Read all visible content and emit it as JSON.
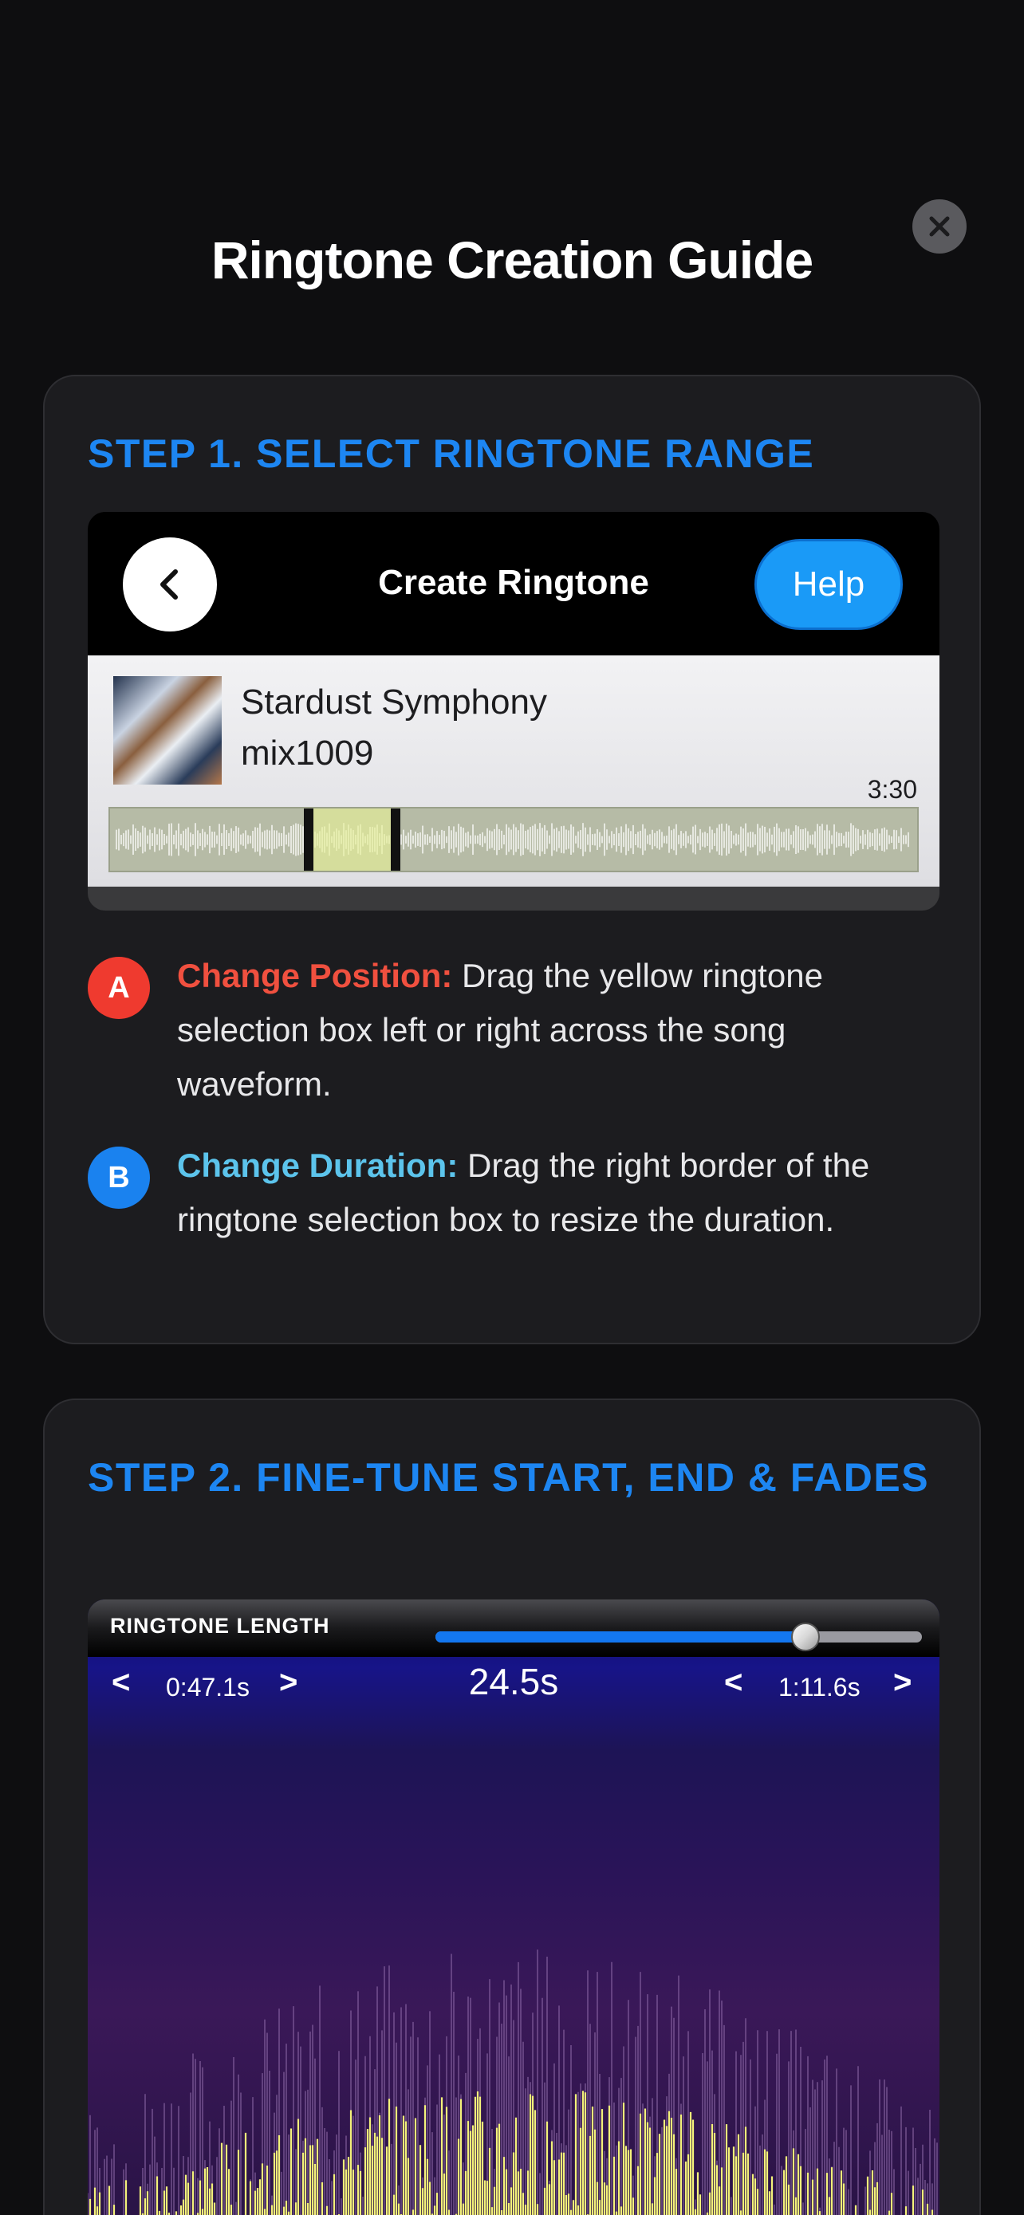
{
  "title": "Ringtone Creation Guide",
  "close_icon": "close-icon",
  "step1": {
    "title": "STEP 1. SELECT RINGTONE RANGE",
    "screenshot": {
      "header_title": "Create Ringtone",
      "help_label": "Help",
      "song_name": "Stardust Symphony",
      "song_artist": "mix1009",
      "duration": "3:30",
      "selection_start_fraction": 0.24,
      "selection_end_fraction": 0.36
    },
    "instructions": [
      {
        "badge": "A",
        "keyword": "Change Position:",
        "text": " Drag the yellow ringtone selection box left or right across the song waveform.",
        "color": "#ef3a2f"
      },
      {
        "badge": "B",
        "keyword": "Change Duration:",
        "text": " Drag the right border of the ringtone selection box to resize the duration.",
        "color": "#1a82ef"
      }
    ]
  },
  "step2": {
    "title": "STEP 2. FINE-TUNE START, END & FADES",
    "screenshot": {
      "length_label": "RINGTONE LENGTH",
      "slider_fraction": 0.76,
      "start_prev": "<",
      "start_time": "0:47.1s",
      "start_next": ">",
      "length": "24.5s",
      "end_prev": "<",
      "end_time": "1:11.6s",
      "end_next": ">"
    }
  },
  "colors": {
    "accent": "#1d86f2",
    "waveform_yellow": "#f4f27a",
    "background": "#0e0e10",
    "card": "#1c1c1f"
  }
}
